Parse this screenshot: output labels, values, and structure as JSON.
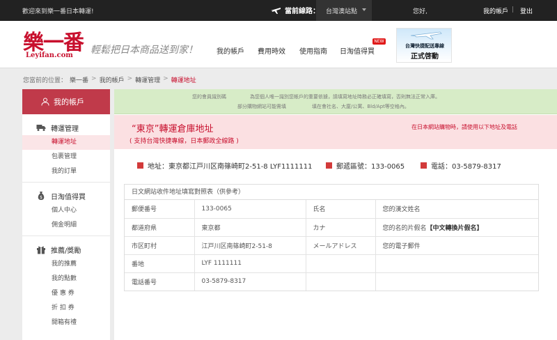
{
  "topbar": {
    "welcome": "歡迎來到樂一番日本轉運!",
    "route_label": "當前線路：",
    "route_value": "台灣澳站點",
    "hello": "您好,",
    "account": "我的帳戶",
    "separator": "|",
    "logout": "登出"
  },
  "header": {
    "logo_cn": "樂一番",
    "logo_en": "Leyifan.com",
    "slogan": "輕鬆把日本商品送到家！",
    "nav": [
      "我的帳戶",
      "費用時效",
      "使用指南",
      "日淘值得買"
    ],
    "new_badge": "NEW",
    "banner_line1": "台灣快捷配送專線",
    "banner_line2": "正式啓動"
  },
  "breadcrumb": {
    "prefix": "您當前的位置：",
    "items": [
      "樂一番",
      "我的帳戶",
      "轉運管理",
      "轉運地址"
    ],
    "sep": ">"
  },
  "sidebar": {
    "title": "我的帳戶",
    "groups": [
      {
        "title": "轉運管理",
        "items": [
          "轉運地址",
          "包裹管理",
          "我的訂單"
        ]
      },
      {
        "title": "日淘值得買",
        "items": [
          "個人中心",
          "佣金明細"
        ]
      },
      {
        "title": "推薦/獎勵",
        "items": [
          "我的推薦",
          "我的點數",
          "優 惠 券",
          "折 扣 券",
          "開箱有禮"
        ]
      }
    ]
  },
  "notice": {
    "line1a": "您的會員識別碼",
    "line1b": "為您個人唯一識別您帳戶的重要依據，請填寫地址時務必正確填寫，否則無法正常入庫。",
    "line2a": "部分購物網站可能需填",
    "line2b": "填在會社名、大廈/公寓、Bld/Apt等空格內。"
  },
  "warehouse": {
    "title": "“東京”轉運倉庫地址",
    "subtitle": "( 支持台灣快捷專線，日本郵政全線路 )",
    "right_note": "在日本網站購物時，請使用以下地址及電話",
    "address": "地址：東京都江戸川区南篠崎町2-51-8 LYF1111111",
    "zip": "郵遞區號：133-0065",
    "tel": "電話：03-5879-8317"
  },
  "table": {
    "caption": "日文網站收件地址填寫對照表（供參考）",
    "rows": [
      [
        "郵便番号",
        "133-0065",
        "氏名",
        "您的漢文姓名"
      ],
      [
        "都道府県",
        "東京都",
        "カナ",
        "您的名的片假名"
      ],
      [
        "市区町村",
        "江戸川区南篠崎町2-51-8",
        "メールアドレス",
        "您的電子郵件"
      ],
      [
        "番地",
        "LYF 1111111",
        "",
        ""
      ],
      [
        "電話番号",
        "03-5879-8317",
        "",
        ""
      ]
    ],
    "kana_extra": "【中文轉換片假名】"
  },
  "colors": {
    "brand_red": "#c8102e",
    "sidebar_head": "#c03a4a",
    "notice_green": "#d7ecc7",
    "pink_box": "#fbe0e2"
  }
}
